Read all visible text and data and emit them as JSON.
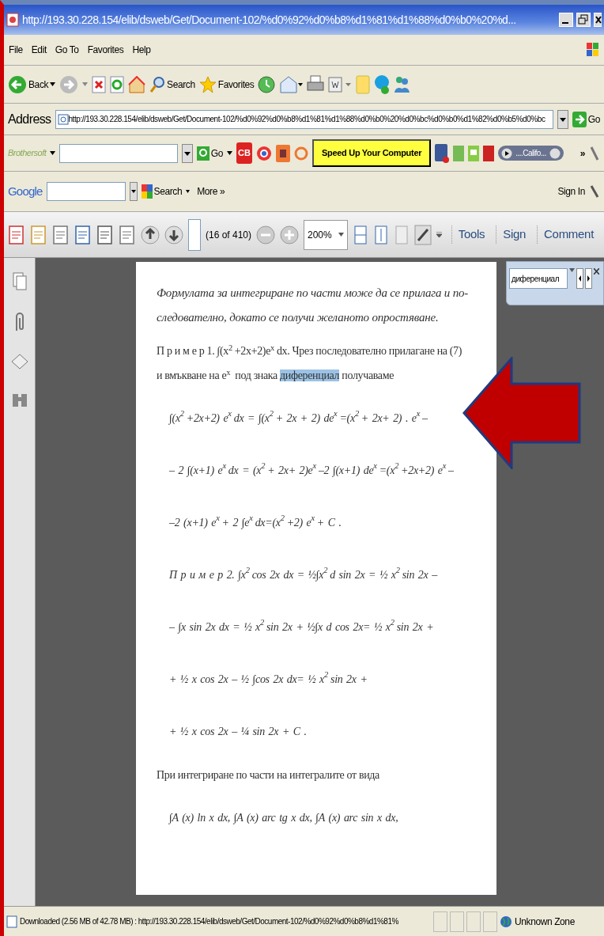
{
  "window": {
    "title": "http://193.30.228.154/elib/dsweb/Get/Document-102/%d0%92%d0%b8%d1%81%d1%88%d0%b0%20%d..."
  },
  "menu": [
    "File",
    "Edit",
    "Go To",
    "Favorites",
    "Help"
  ],
  "toolbar": {
    "back": "Back",
    "search": "Search",
    "favorites": "Favorites"
  },
  "address": {
    "label": "Address",
    "value": "http://193.30.228.154/elib/dsweb/Get/Document-102/%d0%92%d0%b8%d1%81%d1%88%d0%b0%20%d0%bc%d0%b0%d1%82%d0%b5%d0%bc",
    "go": "Go"
  },
  "brothersoft_bar": {
    "logo": "Brothersoft",
    "go": "Go",
    "cb": "CB",
    "promo": "Speed Up Your Computer",
    "radio": "....Califo...",
    "more": "»"
  },
  "google_bar": {
    "logo": "Google",
    "search": "Search",
    "more": "More »",
    "sign_in": "Sign In"
  },
  "pdf_toolbar": {
    "page_of": "(16 of 410)",
    "zoom": "200%",
    "links": [
      "Tools",
      "Sign",
      "Comment"
    ]
  },
  "find": {
    "value": "диференциал"
  },
  "document": {
    "lines": [
      {
        "kind": "italic",
        "text": "Формулата за интегриране по части може да се прилага и по-"
      },
      {
        "kind": "italic",
        "text": "следователно, докато се получи желаното опростяване."
      },
      {
        "kind": "plain",
        "text": "П р и м е р 1. ∫(x$^{2}$+2x+2)e$^{x}$dx. Чрез последователно прилагане на (7)"
      },
      {
        "kind": "plain",
        "segments": [
          {
            "text": "и вмъкване на e$^{x}$ под знака ",
            "selected": false
          },
          {
            "text": "диференциал",
            "selected": true
          },
          {
            "text": " получаваме",
            "selected": false
          }
        ]
      },
      {
        "kind": "formula",
        "text": "∫(x$^{2}$+2x+2) e$^{x}$ dx = ∫(x$^{2}$+ 2x + 2) de$^{x}$=(x$^{2}$+ 2x+ 2) . e$^{x}$ –"
      },
      {
        "kind": "formula",
        "text": "– 2 ∫(x+1) e$^{x}$ dx = (x$^{2}$+ 2x+ 2)e$^{x}$–2 ∫(x+1) de$^{x}$=(x$^{2}$+2x+2) e$^{x}$–"
      },
      {
        "kind": "formula",
        "text": "–2 (x+1) e$^{x}$+ 2 ∫e$^{x}$ dx=(x$^{2}$+2) e$^{x}$+ C ."
      },
      {
        "kind": "formula",
        "text": "П р и м е р 2. ∫x$^{2}$ cos 2x dx = ½∫x$^{2}$ d sin 2x = ½ x$^{2}$ sin 2x –"
      },
      {
        "kind": "formula",
        "text": "– ∫x sin 2x dx = ½ x$^{2}$ sin 2x + ½∫x d cos 2x= ½ x$^{2}$ sin 2x +"
      },
      {
        "kind": "formula",
        "text": "+ ½ x cos 2x – ½ ∫cos 2x dx= ½ x$^{2}$ sin 2x +"
      },
      {
        "kind": "formula",
        "text": "+ ½ x cos 2x – ¼ sin 2x + C ."
      },
      {
        "kind": "plain",
        "text": "При интегриране по части на интегралите от вида"
      },
      {
        "kind": "formula",
        "text": "∫A (x) ln x dx,   ∫A (x) arc tg x dx,   ∫A (x) arc sin x dx,"
      }
    ]
  },
  "status_bar": {
    "text": "Downloaded (2.56 MB of 42.78 MB) : http://193.30.228.154/elib/dsweb/Get/Document-102/%d0%92%d0%b8%d1%81%",
    "zone": "Unknown Zone"
  }
}
